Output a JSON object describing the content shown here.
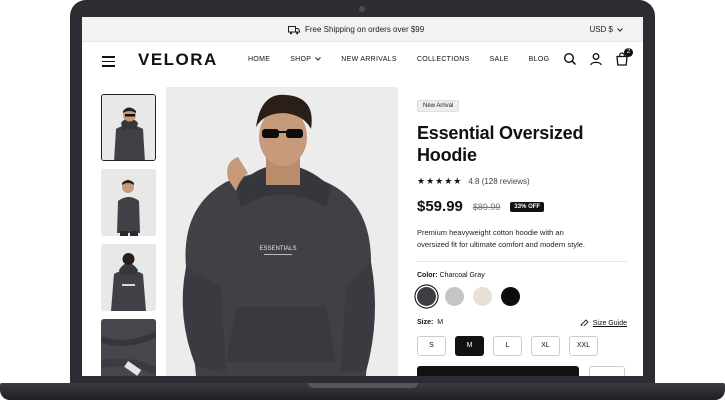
{
  "topbar": {
    "shipping_text": "Free Shipping on orders over $99",
    "currency": "USD $"
  },
  "header": {
    "logo": "VELORA",
    "nav": [
      "HOME",
      "SHOP",
      "NEW ARRIVALS",
      "COLLECTIONS",
      "SALE",
      "BLOG"
    ],
    "cart_count": "2"
  },
  "product": {
    "badge": "New Arrival",
    "title_line1": "Essential Oversized",
    "title_line2": "Hoodie",
    "stars": "★★★★★",
    "rating": "4.8 (128 reviews)",
    "price": "$59.99",
    "old_price": "$89.99",
    "discount": "33% OFF",
    "description": "Premium heavyweight cotton hoodie with an oversized fit for ultimate comfort and modern style.",
    "color_label": "Color:",
    "color_value": "Charcoal Gray",
    "colors": [
      "#3d3e42",
      "#c4c5c7",
      "#e8e0d2",
      "#0c0c0c"
    ],
    "size_label": "Size:",
    "size_value": "M",
    "size_guide": "Size Guide",
    "sizes": [
      "S",
      "M",
      "L",
      "XL",
      "XXL"
    ],
    "selected_size": "M",
    "hoodie_print": "ESSENTIALS"
  },
  "colors": {
    "accent": "#111111",
    "laptop": "#2b2d33",
    "hoodie": "#3f4147"
  }
}
